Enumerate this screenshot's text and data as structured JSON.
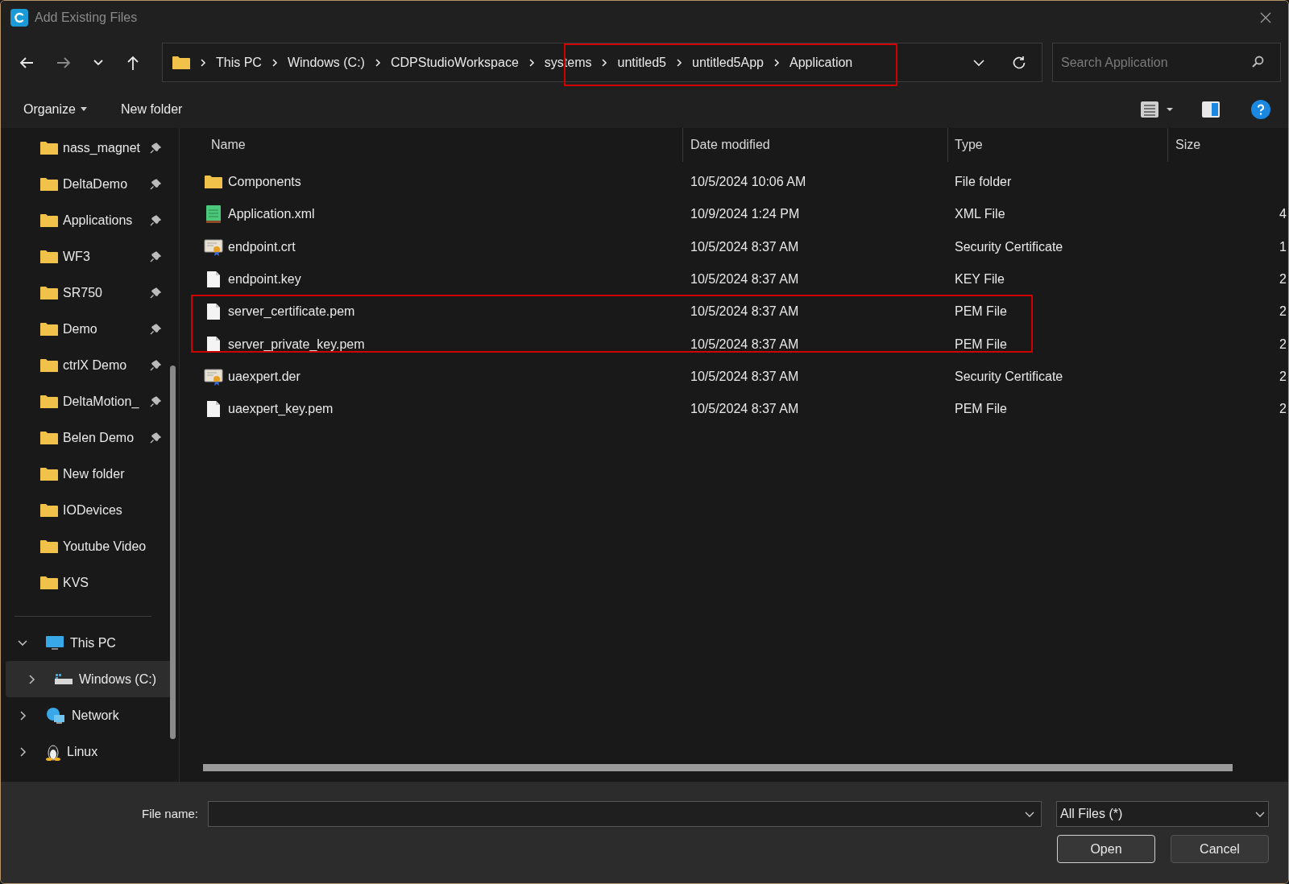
{
  "window": {
    "title": "Add Existing Files"
  },
  "breadcrumbs": [
    "This PC",
    "Windows (C:)",
    "CDPStudioWorkspace",
    "systems",
    "untitled5",
    "untitled5App",
    "Application"
  ],
  "search": {
    "placeholder": "Search Application"
  },
  "toolbar": {
    "organize": "Organize",
    "new_folder": "New folder"
  },
  "sidebar": {
    "quick_access": [
      {
        "label": "nass_magnet",
        "pinned": true
      },
      {
        "label": "DeltaDemo",
        "pinned": true
      },
      {
        "label": "Applications",
        "pinned": true
      },
      {
        "label": "WF3",
        "pinned": true
      },
      {
        "label": "SR750",
        "pinned": true
      },
      {
        "label": "Demo",
        "pinned": true
      },
      {
        "label": "ctrlX Demo",
        "pinned": true
      },
      {
        "label": "DeltaMotion_",
        "pinned": true
      },
      {
        "label": "Belen Demo",
        "pinned": true
      },
      {
        "label": "New folder",
        "pinned": false
      },
      {
        "label": "IODevices",
        "pinned": false
      },
      {
        "label": "Youtube Video",
        "pinned": false
      },
      {
        "label": "KVS",
        "pinned": false
      }
    ],
    "tree": [
      {
        "label": "This PC",
        "kind": "pc",
        "expanded": true,
        "selected": false,
        "children": [
          {
            "label": "Windows (C:)",
            "kind": "drive",
            "expanded": false,
            "selected": true
          }
        ]
      },
      {
        "label": "Network",
        "kind": "network",
        "expanded": false,
        "selected": false
      },
      {
        "label": "Linux",
        "kind": "linux",
        "expanded": false,
        "selected": false
      }
    ]
  },
  "table": {
    "columns": [
      "Name",
      "Date modified",
      "Type",
      "Size"
    ],
    "rows": [
      {
        "kind": "folder",
        "name": "Components",
        "date": "10/5/2024 10:06 AM",
        "type": "File folder",
        "size": ""
      },
      {
        "kind": "xml",
        "name": "Application.xml",
        "date": "10/9/2024 1:24 PM",
        "type": "XML File",
        "size": "4"
      },
      {
        "kind": "cert",
        "name": "endpoint.crt",
        "date": "10/5/2024 8:37 AM",
        "type": "Security Certificate",
        "size": "1"
      },
      {
        "kind": "file",
        "name": "endpoint.key",
        "date": "10/5/2024 8:37 AM",
        "type": "KEY File",
        "size": "2"
      },
      {
        "kind": "file",
        "name": "server_certificate.pem",
        "date": "10/5/2024 8:37 AM",
        "type": "PEM File",
        "size": "2"
      },
      {
        "kind": "file",
        "name": "server_private_key.pem",
        "date": "10/5/2024 8:37 AM",
        "type": "PEM File",
        "size": "2"
      },
      {
        "kind": "cert",
        "name": "uaexpert.der",
        "date": "10/5/2024 8:37 AM",
        "type": "Security Certificate",
        "size": "2"
      },
      {
        "kind": "file",
        "name": "uaexpert_key.pem",
        "date": "10/5/2024 8:37 AM",
        "type": "PEM File",
        "size": "2"
      }
    ]
  },
  "footer": {
    "file_name_label": "File name:",
    "filter": "All Files (*)",
    "buttons": [
      "Open",
      "Cancel"
    ]
  }
}
